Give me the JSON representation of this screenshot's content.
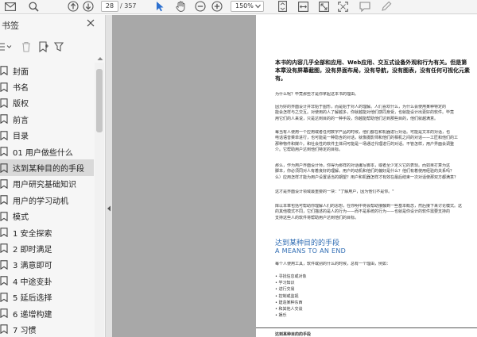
{
  "toolbar": {
    "icons": [
      "mail-icon",
      "search-icon",
      "arrow-up-icon",
      "arrow-down-icon",
      "pointer-icon",
      "hand-icon",
      "zoom-out-icon",
      "zoom-in-icon",
      "fit-page-icon",
      "fit-width-icon",
      "rotate-icon",
      "fullscreen-icon",
      "comment-icon",
      "pen-icon"
    ],
    "current_page": "28",
    "total_pages": "/ 357",
    "zoom": "150%"
  },
  "sidebar": {
    "title": "书签",
    "tools": [
      "outline-menu-icon",
      "delete-icon",
      "new-bookmark-icon"
    ],
    "items": [
      {
        "label": "封面",
        "selected": false
      },
      {
        "label": "书名",
        "selected": false
      },
      {
        "label": "版权",
        "selected": false
      },
      {
        "label": "前言",
        "selected": false
      },
      {
        "label": "目录",
        "selected": false
      },
      {
        "label": "01  用户做些什么",
        "selected": false
      },
      {
        "label": "达到某种目的的手段",
        "selected": true
      },
      {
        "label": "用户研究基础知识",
        "selected": false
      },
      {
        "label": "用户的学习动机",
        "selected": false
      },
      {
        "label": "模式",
        "selected": false
      },
      {
        "label": "1  安全探索",
        "selected": false
      },
      {
        "label": "2  即时满足",
        "selected": false
      },
      {
        "label": "3  满意即可",
        "selected": false
      },
      {
        "label": "4    中途变卦",
        "selected": false
      },
      {
        "label": "5  延后选择",
        "selected": false
      },
      {
        "label": "6  递增构建",
        "selected": false
      },
      {
        "label": "7    习惯",
        "selected": false
      }
    ]
  },
  "document": {
    "intro": [
      "本书的内容几乎全部和应用、Web应用、交互式设备外观和行为有关。但是第",
      "本章没有屏幕截图，没有界面布局，没有导航，没有图表，没有任何可视化元素",
      "有。"
    ],
    "paragraphs": [
      [
        "为什么呢？毕竟那些才是你拿起这本书的理由。"
      ],
      [
        "因为好的界面设计并非始于图形，而是始于对人的理解。人们喜欢什么，为什么会使用某种特定的",
        "能会怎样与之交互。对使用的人了解越多，你就越能对他们感同身受，也就能设计出更好的软件。毕竟",
        "用它们的人来说，只是达到目的的一种手段，你越能帮助他们达到那些目的，他们就越满意。"
      ],
      [
        "每当有人使用一个应用或者任何数字产品的时候，他们都在和机器进行对话。可能是文本的对话，也",
        "电话语音菜单进行，也可能是一种隐含的对话，就像摄影师和他们的相机之间的对话——工匠和他们的工",
        "那种物件和媒介。和社会性的软件主体间可能是一场通过代理进行的对话。不管怎样，用户界面会调整",
        "介。它帮助用户达到他们特定的目标。"
      ],
      [
        "那么，作为用户界面设计师，你得为那样的对话编写脚本，或者至少定义它的表现。而如果打算为这",
        "脚本，你必须同对人有着良好的理解。用户的动机和他们的偏好是什么？他们有着使用经验的关系吗？",
        "么）应用怎样才能为用户设置适当的期望？用户和机器怎样才有效在最后结束一次对话使那双方都满意？"
      ],
      [
        "这才是界面设计领域最重要的一块：\"了解用户，因为他们不是你。\""
      ],
      [
        "库以本章包括可帮助你理解人们的思想，在你明中将会帮助接触到一些基本概念，然后接下来讨论模式。这",
        "的其他模式不同，它们描述的是人的行为——而不是系统的行为——也就是你设计的软件需要支持的",
        "支持这些人的软件将帮助用户达到他们的目标。"
      ]
    ],
    "heading": "达到某种目的的手段",
    "subheading": "A MEANS TO AN END",
    "lead": "每个人使用工具，软件或别的什么的时候，总有一个理由，例如：",
    "bullets": [
      "寻找信息或对象",
      "学习知识",
      "进行交易",
      "控制或监视",
      "建造某种东西",
      "和其他人交谈",
      "娱乐"
    ],
    "footer": "达到某种目的的手段"
  }
}
